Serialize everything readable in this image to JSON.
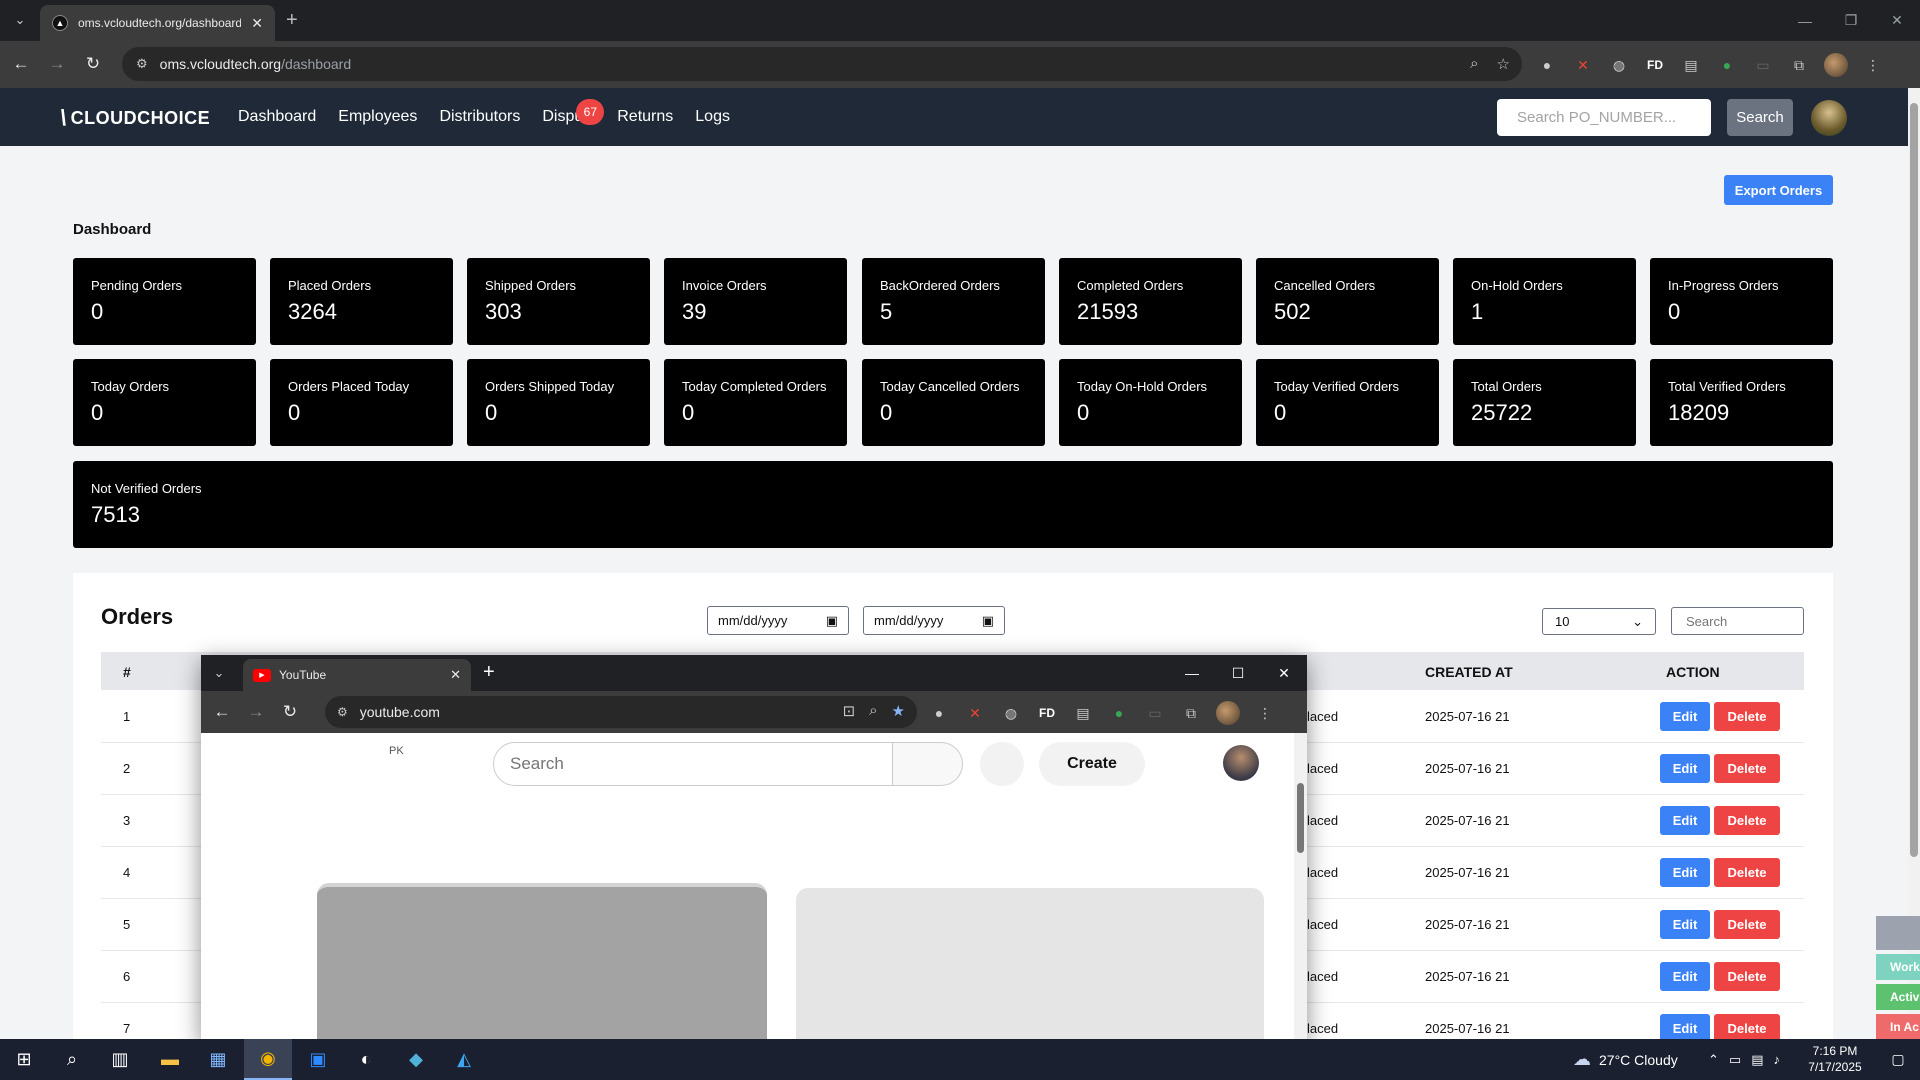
{
  "browser": {
    "tab_title": "oms.vcloudtech.org/dashboard",
    "url_host": "oms.vcloudtech.org",
    "url_path": "/dashboard"
  },
  "nav": {
    "logo": "CLOUDCHOICE",
    "links": [
      "Dashboard",
      "Employees",
      "Distributors",
      "Dispu",
      "Returns",
      "Logs"
    ],
    "disputes_badge": "67",
    "search_placeholder": "Search PO_NUMBER...",
    "search_button": "Search"
  },
  "dashboard": {
    "export_button": "Export Orders",
    "title": "Dashboard",
    "stats": [
      {
        "label": "Pending Orders",
        "value": "0"
      },
      {
        "label": "Placed Orders",
        "value": "3264"
      },
      {
        "label": "Shipped Orders",
        "value": "303"
      },
      {
        "label": "Invoice Orders",
        "value": "39"
      },
      {
        "label": "BackOrdered Orders",
        "value": "5"
      },
      {
        "label": "Completed Orders",
        "value": "21593"
      },
      {
        "label": "Cancelled Orders",
        "value": "502"
      },
      {
        "label": "On-Hold Orders",
        "value": "1"
      },
      {
        "label": "In-Progress Orders",
        "value": "0"
      },
      {
        "label": "Today Orders",
        "value": "0"
      },
      {
        "label": "Orders Placed Today",
        "value": "0"
      },
      {
        "label": "Orders Shipped Today",
        "value": "0"
      },
      {
        "label": "Today Completed Orders",
        "value": "0"
      },
      {
        "label": "Today Cancelled Orders",
        "value": "0"
      },
      {
        "label": "Today On-Hold Orders",
        "value": "0"
      },
      {
        "label": "Today Verified Orders",
        "value": "0"
      },
      {
        "label": "Total Orders",
        "value": "25722"
      },
      {
        "label": "Total Verified Orders",
        "value": "18209"
      },
      {
        "label": "Not Verified Orders",
        "value": "7513"
      }
    ]
  },
  "orders": {
    "title": "Orders",
    "date_from_placeholder": "mm/dd/yyyy",
    "date_to_placeholder": "mm/dd/yyyy",
    "page_size": "10",
    "search_placeholder": "Search",
    "columns": {
      "num": "#",
      "created_at": "CREATED AT",
      "action": "ACTION"
    },
    "edit_label": "Edit",
    "delete_label": "Delete",
    "rows": [
      {
        "num": "1",
        "status": "laced",
        "created_at": "2025-07-16 21"
      },
      {
        "num": "2",
        "status": "laced",
        "created_at": "2025-07-16 21"
      },
      {
        "num": "3",
        "status": "laced",
        "created_at": "2025-07-16 21"
      },
      {
        "num": "4",
        "status": "laced",
        "created_at": "2025-07-16 21"
      },
      {
        "num": "5",
        "status": "laced",
        "created_at": "2025-07-16 21"
      },
      {
        "num": "6",
        "status": "laced",
        "created_at": "2025-07-16 21"
      },
      {
        "num": "7",
        "status": "laced",
        "created_at": "2025-07-16 21"
      }
    ]
  },
  "side_tags": [
    "Work",
    "Activ",
    "In Ac"
  ],
  "side_tag_colors": [
    "#7dd3c0",
    "#5cc270",
    "#ef6b6b"
  ],
  "youtube_window": {
    "tab_title": "YouTube",
    "url": "youtube.com",
    "region": "PK",
    "search_placeholder": "Search",
    "create_label": "Create"
  },
  "taskbar": {
    "weather": "27°C  Cloudy",
    "time": "7:16 PM",
    "date": "7/17/2025"
  },
  "colors": {
    "navbar": "#1f2937",
    "primary": "#3b82f6",
    "danger": "#ef4444",
    "badge": "#ef4444"
  }
}
